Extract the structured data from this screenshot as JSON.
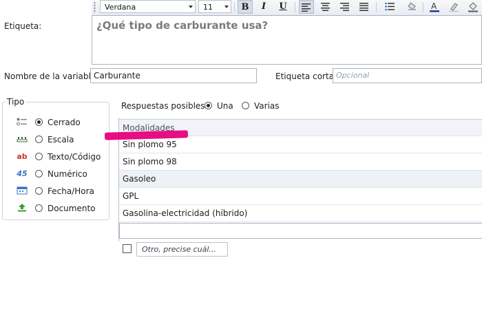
{
  "toolbar": {
    "font_name": "Verdana",
    "font_size": "11",
    "bold": "B",
    "italic": "I",
    "underline": "U",
    "align_icons": [
      "align-left-icon",
      "align-center-icon",
      "align-right-icon",
      "align-justify-icon"
    ],
    "accent_color": "#1f6fd1"
  },
  "question": {
    "label": "Etiqueta:",
    "text": "¿Qué tipo de carburante usa?"
  },
  "variable": {
    "name_label": "Nombre de la variable:",
    "name_value": "Carburante",
    "short_label": "Etiqueta corta:",
    "short_placeholder": "Opcional"
  },
  "tipo": {
    "title": "Tipo",
    "options": [
      {
        "label": "Cerrado",
        "checked": true
      },
      {
        "label": "Escala",
        "checked": false
      },
      {
        "label": "Texto/Código",
        "checked": false
      },
      {
        "label": "Numérico",
        "checked": false
      },
      {
        "label": "Fecha/Hora",
        "checked": false
      },
      {
        "label": "Documento",
        "checked": false
      }
    ],
    "icon_text": {
      "texto": "ab",
      "numerico": "45"
    }
  },
  "respuestas": {
    "label": "Respuestas posibles:",
    "una": "Una",
    "varias": "Varias",
    "selected": "Una"
  },
  "modalidades": {
    "header": "Modalidades",
    "items": [
      "Sin plomo 95",
      "Sin plomo 98",
      "Gasoleo",
      "GPL",
      "Gasolina-electricidad (híbrido)"
    ],
    "highlighted_row": 2,
    "new_value": ""
  },
  "otro": {
    "checked": false,
    "label": "Otro, precise cuál..."
  },
  "annotation_color": "#e5007e"
}
